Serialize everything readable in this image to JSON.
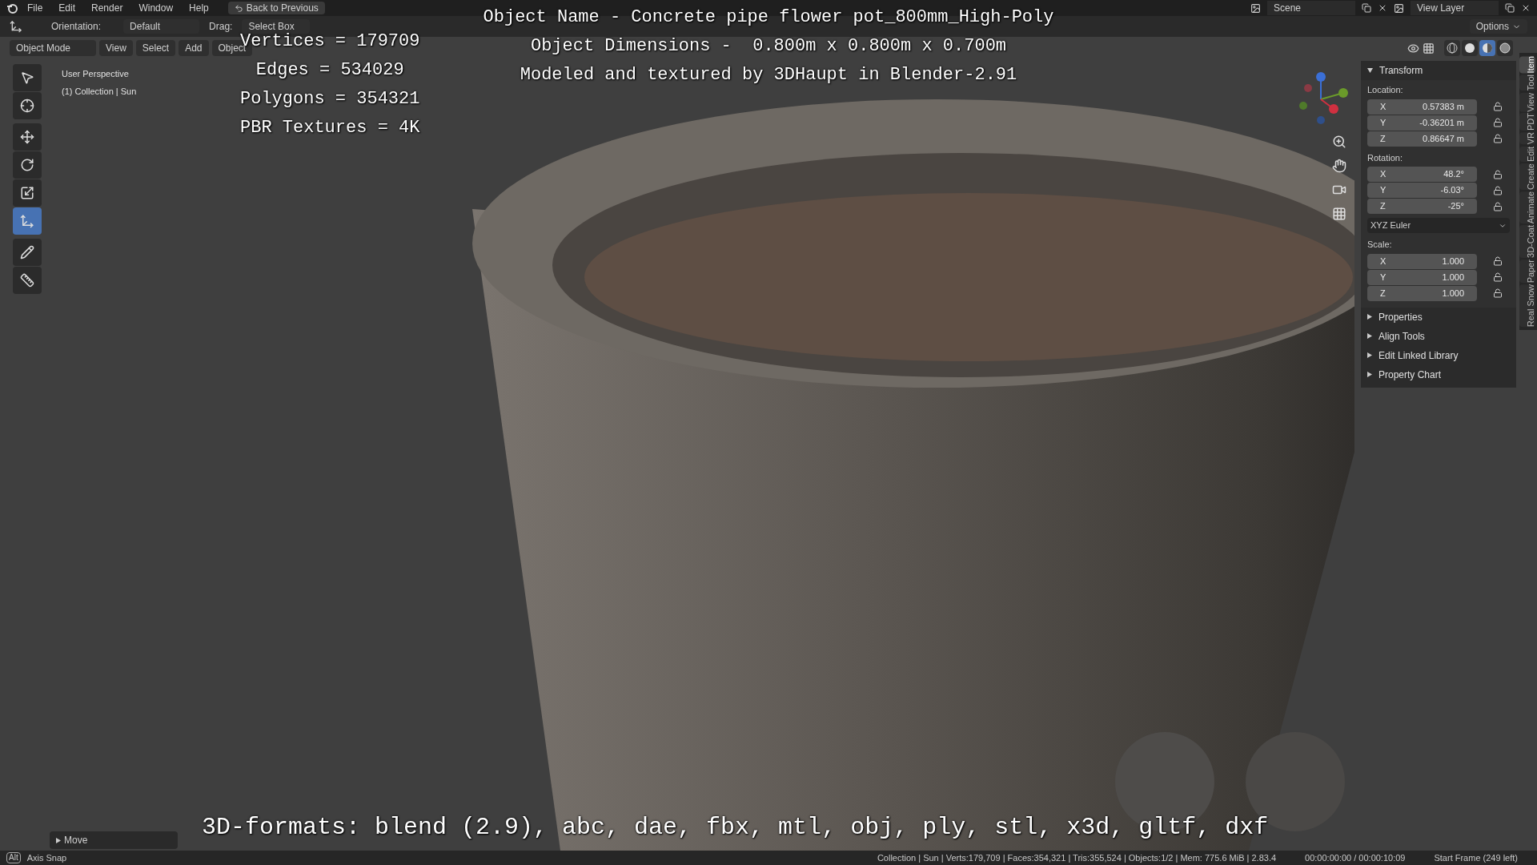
{
  "menu": [
    {
      "label": "File"
    },
    {
      "label": "Edit"
    },
    {
      "label": "Render"
    },
    {
      "label": "Window"
    },
    {
      "label": "Help"
    }
  ],
  "back_button": "Back to Previous",
  "scene": "Scene",
  "view_layer": "View Layer",
  "tool_header": {
    "orientation_label": "Orientation:",
    "orientation": "Default",
    "drag_label": "Drag:",
    "drag": "Select Box",
    "options": "Options"
  },
  "view_header": {
    "mode": "Object Mode",
    "menus": [
      "View",
      "Select",
      "Add",
      "Object"
    ]
  },
  "shading_modes": [
    {
      "kind": "wireframe",
      "selected": false
    },
    {
      "kind": "solid",
      "selected": false
    },
    {
      "kind": "material",
      "selected": true
    },
    {
      "kind": "rendered",
      "selected": false
    }
  ],
  "viewport_info": [
    "User Perspective",
    "(1) Collection | Sun"
  ],
  "tools": [
    {
      "kind": "select",
      "selected": false
    },
    {
      "kind": "cursor",
      "selected": false
    },
    {
      "kind": "move",
      "selected": false
    },
    {
      "kind": "rotate",
      "selected": false
    },
    {
      "kind": "scale",
      "selected": false
    },
    {
      "kind": "transform",
      "selected": true
    },
    {
      "kind": "annotate",
      "selected": false
    },
    {
      "kind": "measure",
      "selected": false
    }
  ],
  "overlay": {
    "stats": [
      "Vertices = 179709",
      "Edges = 534029",
      "Polygons = 354321",
      "PBR Textures = 4K"
    ],
    "title_lines": [
      "Object Name - Concrete pipe flower pot_800mm_High-Poly",
      "Object Dimensions -  0.800m x 0.800m x 0.700m",
      "Modeled and textured by 3DHaupt in Blender-2.91"
    ],
    "formats": "3D-formats: blend (2.9), abc, dae, fbx, mtl, obj, ply, stl, x3d, gltf, dxf"
  },
  "sidebar": {
    "tabs": [
      {
        "label": "Item",
        "selected": true
      },
      {
        "label": "Tool",
        "selected": false
      },
      {
        "label": "View",
        "selected": false
      },
      {
        "label": "PDT",
        "selected": false
      },
      {
        "label": "VR",
        "selected": false
      },
      {
        "label": "Edit",
        "selected": false
      },
      {
        "label": "Create",
        "selected": false
      },
      {
        "label": "Animate",
        "selected": false
      },
      {
        "label": "3D-Coat",
        "selected": false
      },
      {
        "label": "Paper",
        "selected": false
      },
      {
        "label": "Real Snow",
        "selected": false
      }
    ],
    "panels": [
      {
        "title": "Transform",
        "expanded": true
      },
      {
        "title": "Properties",
        "expanded": false
      },
      {
        "title": "Align Tools",
        "expanded": false
      },
      {
        "title": "Edit Linked Library",
        "expanded": false
      },
      {
        "title": "Property Chart",
        "expanded": false
      }
    ],
    "transform": {
      "groups": [
        {
          "label": "Location:",
          "fields": [
            {
              "axis": "X",
              "value": "0.57383 m"
            },
            {
              "axis": "Y",
              "value": "-0.36201 m"
            },
            {
              "axis": "Z",
              "value": "0.86647 m"
            }
          ]
        },
        {
          "label": "Rotation:",
          "fields": [
            {
              "axis": "X",
              "value": "48.2°"
            },
            {
              "axis": "Y",
              "value": "-6.03°"
            },
            {
              "axis": "Z",
              "value": "-25°"
            }
          ],
          "mode": "XYZ Euler"
        },
        {
          "label": "Scale:",
          "fields": [
            {
              "axis": "X",
              "value": "1.000"
            },
            {
              "axis": "Y",
              "value": "1.000"
            },
            {
              "axis": "Z",
              "value": "1.000"
            }
          ]
        }
      ]
    }
  },
  "last_operator": {
    "label": "Move",
    "expanded": false
  },
  "status_bar": {
    "key": "Alt",
    "hint": "Axis Snap",
    "stats": "Collection | Sun | Verts:179,709 | Faces:354,321 | Tris:355,524 | Objects:1/2 | Mem: 775.6 MiB | 2.83.4",
    "time": "00:00:00:00 / 00:00:10:09",
    "frame": "Start Frame (249 left)"
  }
}
